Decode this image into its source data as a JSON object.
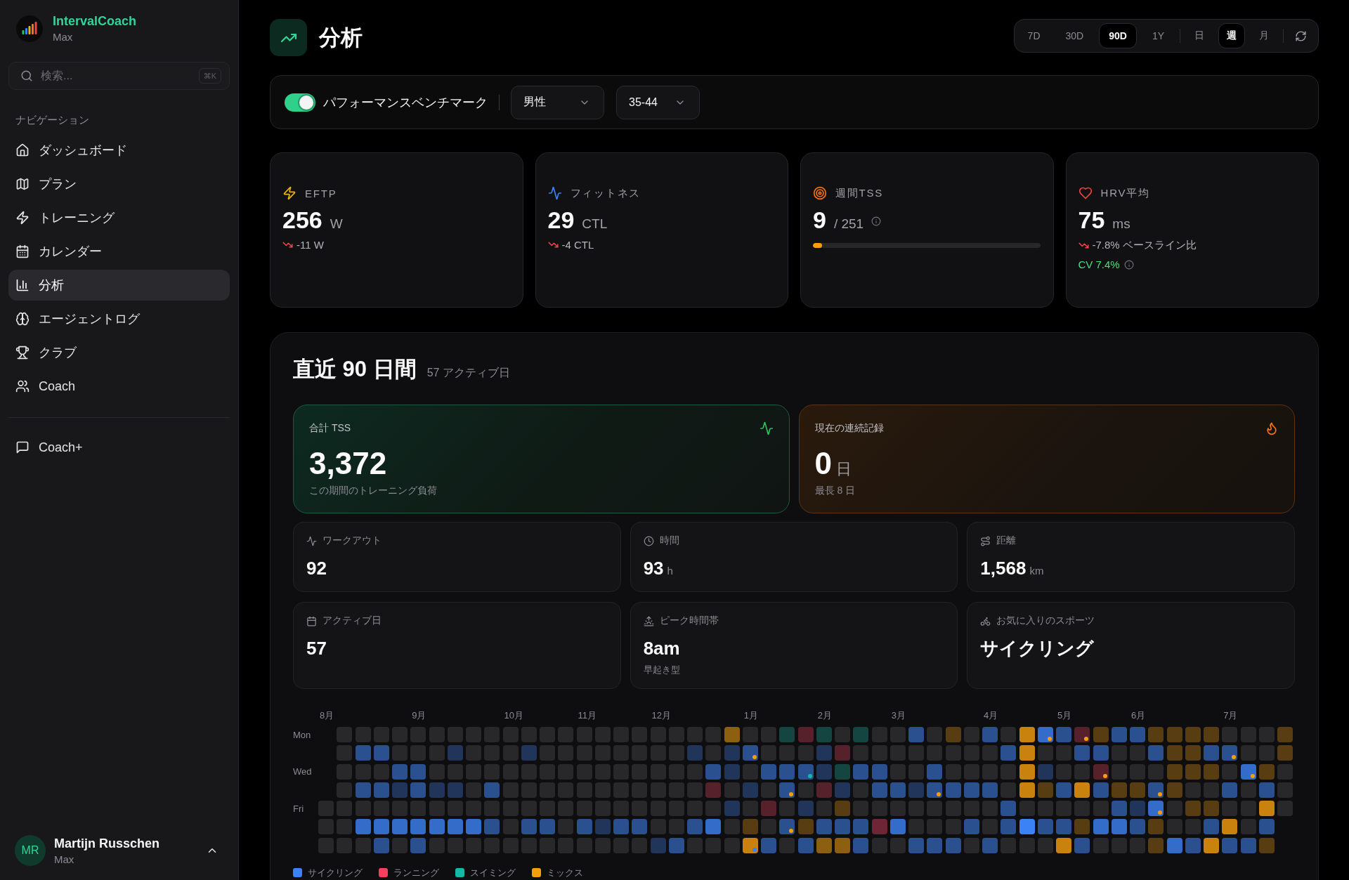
{
  "sidebar": {
    "brand": {
      "name": "IntervalCoach",
      "plan": "Max"
    },
    "search": {
      "placeholder": "検索...",
      "shortcut": "⌘K"
    },
    "section_label": "ナビゲーション",
    "items": [
      {
        "label": "ダッシュボード",
        "selected": false
      },
      {
        "label": "プラン",
        "selected": false
      },
      {
        "label": "トレーニング",
        "selected": false
      },
      {
        "label": "カレンダー",
        "selected": false
      },
      {
        "label": "分析",
        "selected": true
      },
      {
        "label": "エージェントログ",
        "selected": false
      },
      {
        "label": "クラブ",
        "selected": false
      },
      {
        "label": "Coach",
        "selected": false
      }
    ],
    "secondary_items": [
      {
        "label": "Coach+",
        "selected": false
      }
    ],
    "user": {
      "initials": "MR",
      "name": "Martijn Russchen",
      "plan": "Max"
    }
  },
  "header": {
    "title": "分析",
    "ranges": [
      {
        "label": "7D",
        "selected": false
      },
      {
        "label": "30D",
        "selected": false
      },
      {
        "label": "90D",
        "selected": true
      },
      {
        "label": "1Y",
        "selected": false
      }
    ],
    "granularity": [
      {
        "label": "日",
        "selected": false
      },
      {
        "label": "週",
        "selected": true
      },
      {
        "label": "月",
        "selected": false
      }
    ]
  },
  "benchmark": {
    "enabled": true,
    "label": "パフォーマンスベンチマーク",
    "gender": "男性",
    "age_group": "35-44"
  },
  "stats": [
    {
      "kind": "trend",
      "label": "EFTP",
      "value": "256",
      "unit": "W",
      "falling": true,
      "change": "-11 W"
    },
    {
      "kind": "trend",
      "label": "フィットネス",
      "value": "29",
      "unit": "CTL",
      "falling": true,
      "change": "-4 CTL"
    },
    {
      "kind": "progress",
      "label": "週間TSS",
      "value": "9",
      "target": "/ 251",
      "level": 0.04
    },
    {
      "kind": "trend",
      "label": "HRV平均",
      "value": "75",
      "unit": "ms",
      "falling": true,
      "change": "-7.8% ベースライン比",
      "note": "CV 7.4%"
    }
  ],
  "summary": {
    "title": "直近 90 日間",
    "subtitle": "57 アクティブ日",
    "highlights": [
      {
        "kind": "load",
        "label": "合計 TSS",
        "value": "3,372",
        "caption": "この期間のトレーニング負荷"
      },
      {
        "kind": "streak",
        "label": "現在の連続記録",
        "value": "0",
        "unit": "日",
        "caption": "最長 8 日"
      }
    ],
    "metrics": [
      {
        "label": "ワークアウト",
        "value": "92"
      },
      {
        "label": "時間",
        "value": "93",
        "unit": "h"
      },
      {
        "label": "距離",
        "value": "1,568",
        "unit": "km"
      },
      {
        "label": "アクティブ日",
        "value": "57"
      },
      {
        "label": "ピーク時間帯",
        "value": "8am",
        "caption": "早起き型"
      },
      {
        "label": "お気に入りのスポーツ",
        "value": "サイクリング"
      }
    ],
    "heatmap": {
      "day_labels": [
        "Mon",
        "Wed",
        "Fri"
      ],
      "weeks": [
        {
          "month": "8月",
          "days": [
            {
              "color": "#28282b"
            },
            {
              "color": "#28282b"
            },
            {
              "color": "#28282b"
            }
          ]
        },
        {
          "days": [
            {
              "color": "#28282b"
            },
            {
              "color": "#28282b"
            },
            {
              "color": "#28282b"
            },
            {
              "color": "#28282b"
            },
            {
              "color": "#28282b"
            },
            {
              "color": "#28282b"
            },
            {
              "color": "#28282b"
            }
          ]
        },
        {
          "days": [
            {
              "color": "#28282b"
            },
            {
              "color": "#2a508f"
            },
            {
              "color": "#28282b"
            },
            {
              "color": "#2a508f"
            },
            {
              "color": "#28282b"
            },
            {
              "color": "#336cc9"
            },
            {
              "color": "#28282b"
            }
          ]
        },
        {
          "days": [
            {
              "color": "#28282b"
            },
            {
              "color": "#2a508f"
            },
            {
              "color": "#28282b"
            },
            {
              "color": "#2a508f"
            },
            {
              "color": "#28282b"
            },
            {
              "color": "#336cc9"
            },
            {
              "color": "#2a508f"
            }
          ]
        },
        {
          "days": [
            {
              "color": "#28282b"
            },
            {
              "color": "#28282b"
            },
            {
              "color": "#2a508f"
            },
            {
              "color": "#203559"
            },
            {
              "color": "#28282b"
            },
            {
              "color": "#336cc9"
            },
            {
              "color": "#28282b"
            }
          ]
        },
        {
          "month": "9月",
          "days": [
            {
              "color": "#28282b"
            },
            {
              "color": "#28282b"
            },
            {
              "color": "#2a508f"
            },
            {
              "color": "#2a508f"
            },
            {
              "color": "#28282b"
            },
            {
              "color": "#336cc9"
            },
            {
              "color": "#2a508f"
            }
          ]
        },
        {
          "days": [
            {
              "color": "#28282b"
            },
            {
              "color": "#28282b"
            },
            {
              "color": "#28282b"
            },
            {
              "color": "#203559"
            },
            {
              "color": "#28282b"
            },
            {
              "color": "#336cc9"
            },
            {
              "color": "#28282b"
            }
          ]
        },
        {
          "days": [
            {
              "color": "#28282b"
            },
            {
              "color": "#203559"
            },
            {
              "color": "#28282b"
            },
            {
              "color": "#203559"
            },
            {
              "color": "#28282b"
            },
            {
              "color": "#336cc9"
            },
            {
              "color": "#28282b"
            }
          ]
        },
        {
          "days": [
            {
              "color": "#28282b"
            },
            {
              "color": "#28282b"
            },
            {
              "color": "#28282b"
            },
            {
              "color": "#28282b"
            },
            {
              "color": "#28282b"
            },
            {
              "color": "#336cc9"
            },
            {
              "color": "#28282b"
            }
          ]
        },
        {
          "days": [
            {
              "color": "#28282b"
            },
            {
              "color": "#28282b"
            },
            {
              "color": "#28282b"
            },
            {
              "color": "#2a508f"
            },
            {
              "color": "#28282b"
            },
            {
              "color": "#2a508f"
            },
            {
              "color": "#28282b"
            }
          ]
        },
        {
          "month": "10月",
          "days": [
            {
              "color": "#28282b"
            },
            {
              "color": "#28282b"
            },
            {
              "color": "#28282b"
            },
            {
              "color": "#28282b"
            },
            {
              "color": "#28282b"
            },
            {
              "color": "#28282b"
            },
            {
              "color": "#28282b"
            }
          ]
        },
        {
          "days": [
            {
              "color": "#28282b"
            },
            {
              "color": "#203559"
            },
            {
              "color": "#28282b"
            },
            {
              "color": "#28282b"
            },
            {
              "color": "#28282b"
            },
            {
              "color": "#2a508f"
            },
            {
              "color": "#28282b"
            }
          ]
        },
        {
          "days": [
            {
              "color": "#28282b"
            },
            {
              "color": "#28282b"
            },
            {
              "color": "#28282b"
            },
            {
              "color": "#28282b"
            },
            {
              "color": "#28282b"
            },
            {
              "color": "#2a508f"
            },
            {
              "color": "#28282b"
            }
          ]
        },
        {
          "days": [
            {
              "color": "#28282b"
            },
            {
              "color": "#28282b"
            },
            {
              "color": "#28282b"
            },
            {
              "color": "#28282b"
            },
            {
              "color": "#28282b"
            },
            {
              "color": "#28282b"
            },
            {
              "color": "#28282b"
            }
          ]
        },
        {
          "month": "11月",
          "days": [
            {
              "color": "#28282b"
            },
            {
              "color": "#28282b"
            },
            {
              "color": "#28282b"
            },
            {
              "color": "#28282b"
            },
            {
              "color": "#28282b"
            },
            {
              "color": "#2a508f"
            },
            {
              "color": "#28282b"
            }
          ]
        },
        {
          "days": [
            {
              "color": "#28282b"
            },
            {
              "color": "#28282b"
            },
            {
              "color": "#28282b"
            },
            {
              "color": "#28282b"
            },
            {
              "color": "#28282b"
            },
            {
              "color": "#203559"
            },
            {
              "color": "#28282b"
            }
          ]
        },
        {
          "days": [
            {
              "color": "#28282b"
            },
            {
              "color": "#28282b"
            },
            {
              "color": "#28282b"
            },
            {
              "color": "#28282b"
            },
            {
              "color": "#28282b"
            },
            {
              "color": "#2a508f"
            },
            {
              "color": "#28282b"
            }
          ]
        },
        {
          "days": [
            {
              "color": "#28282b"
            },
            {
              "color": "#28282b"
            },
            {
              "color": "#28282b"
            },
            {
              "color": "#28282b"
            },
            {
              "color": "#28282b"
            },
            {
              "color": "#2a508f"
            },
            {
              "color": "#28282b"
            }
          ]
        },
        {
          "month": "12月",
          "days": [
            {
              "color": "#28282b"
            },
            {
              "color": "#28282b"
            },
            {
              "color": "#28282b"
            },
            {
              "color": "#28282b"
            },
            {
              "color": "#28282b"
            },
            {
              "color": "#28282b"
            },
            {
              "color": "#203559"
            }
          ]
        },
        {
          "days": [
            {
              "color": "#28282b"
            },
            {
              "color": "#28282b"
            },
            {
              "color": "#28282b"
            },
            {
              "color": "#28282b"
            },
            {
              "color": "#28282b"
            },
            {
              "color": "#28282b"
            },
            {
              "color": "#2a508f"
            }
          ]
        },
        {
          "days": [
            {
              "color": "#28282b"
            },
            {
              "color": "#203559"
            },
            {
              "color": "#28282b"
            },
            {
              "color": "#28282b"
            },
            {
              "color": "#28282b"
            },
            {
              "color": "#2a508f"
            },
            {
              "color": "#28282b"
            }
          ]
        },
        {
          "days": [
            {
              "color": "#28282b"
            },
            {
              "color": "#28282b"
            },
            {
              "color": "#2a508f"
            },
            {
              "color": "#57212b"
            },
            {
              "color": "#28282b"
            },
            {
              "color": "#336cc9"
            },
            {
              "color": "#28282b"
            }
          ]
        },
        {
          "days": [
            {
              "color": "#8d5f10"
            },
            {
              "color": "#203559"
            },
            {
              "color": "#203559"
            },
            {
              "color": "#28282b"
            },
            {
              "color": "#203559"
            },
            {
              "color": "#28282b"
            },
            {
              "color": "#28282b"
            }
          ]
        },
        {
          "month": "1月",
          "days": [
            {
              "color": "#28282b"
            },
            {
              "color": "#2a508f",
              "dot": {
                "color": "#f59e0b"
              }
            },
            {
              "color": "#28282b"
            },
            {
              "color": "#203559"
            },
            {
              "color": "#28282b"
            },
            {
              "color": "#583d13"
            },
            {
              "color": "#c8820d",
              "dot": {
                "color": "#3b82f6"
              }
            }
          ]
        },
        {
          "days": [
            {
              "color": "#28282b"
            },
            {
              "color": "#28282b"
            },
            {
              "color": "#2a508f"
            },
            {
              "color": "#28282b"
            },
            {
              "color": "#57212b"
            },
            {
              "color": "#28282b"
            },
            {
              "color": "#2a508f"
            }
          ]
        },
        {
          "days": [
            {
              "color": "#144541"
            },
            {
              "color": "#28282b"
            },
            {
              "color": "#2a508f"
            },
            {
              "color": "#2a508f",
              "dot": {
                "color": "#f59e0b"
              }
            },
            {
              "color": "#28282b"
            },
            {
              "color": "#2a508f",
              "dot": {
                "color": "#f59e0b"
              }
            },
            {
              "color": "#28282b"
            }
          ]
        },
        {
          "days": [
            {
              "color": "#57212b"
            },
            {
              "color": "#28282b"
            },
            {
              "color": "#2a508f",
              "dot": {
                "color": "#14b8a6"
              }
            },
            {
              "color": "#28282b"
            },
            {
              "color": "#203559"
            },
            {
              "color": "#583d13"
            },
            {
              "color": "#2a508f"
            }
          ]
        },
        {
          "month": "2月",
          "days": [
            {
              "color": "#144541"
            },
            {
              "color": "#203559"
            },
            {
              "color": "#203559"
            },
            {
              "color": "#57212b"
            },
            {
              "color": "#28282b"
            },
            {
              "color": "#2a508f"
            },
            {
              "color": "#8d5f10"
            }
          ]
        },
        {
          "days": [
            {
              "color": "#28282b"
            },
            {
              "color": "#57212b"
            },
            {
              "color": "#144541"
            },
            {
              "color": "#203559"
            },
            {
              "color": "#583d13"
            },
            {
              "color": "#2a508f"
            },
            {
              "color": "#8d5f10"
            }
          ]
        },
        {
          "days": [
            {
              "color": "#144541"
            },
            {
              "color": "#28282b"
            },
            {
              "color": "#2a508f"
            },
            {
              "color": "#28282b"
            },
            {
              "color": "#28282b"
            },
            {
              "color": "#2a508f"
            },
            {
              "color": "#2a508f"
            }
          ]
        },
        {
          "days": [
            {
              "color": "#28282b"
            },
            {
              "color": "#28282b"
            },
            {
              "color": "#2a508f"
            },
            {
              "color": "#2a508f"
            },
            {
              "color": "#28282b"
            },
            {
              "color": "#6e2535"
            },
            {
              "color": "#28282b"
            }
          ]
        },
        {
          "month": "3月",
          "days": [
            {
              "color": "#28282b"
            },
            {
              "color": "#28282b"
            },
            {
              "color": "#28282b"
            },
            {
              "color": "#2a508f"
            },
            {
              "color": "#28282b"
            },
            {
              "color": "#336cc9"
            },
            {
              "color": "#28282b"
            }
          ]
        },
        {
          "days": [
            {
              "color": "#2a508f"
            },
            {
              "color": "#28282b"
            },
            {
              "color": "#28282b"
            },
            {
              "color": "#203559"
            },
            {
              "color": "#28282b"
            },
            {
              "color": "#28282b"
            },
            {
              "color": "#2a508f"
            }
          ]
        },
        {
          "days": [
            {
              "color": "#28282b"
            },
            {
              "color": "#28282b"
            },
            {
              "color": "#2a508f"
            },
            {
              "color": "#2a508f",
              "dot": {
                "color": "#f59e0b"
              }
            },
            {
              "color": "#28282b"
            },
            {
              "color": "#28282b"
            },
            {
              "color": "#2a508f"
            }
          ]
        },
        {
          "days": [
            {
              "color": "#583d13"
            },
            {
              "color": "#28282b"
            },
            {
              "color": "#28282b"
            },
            {
              "color": "#2a508f"
            },
            {
              "color": "#28282b"
            },
            {
              "color": "#28282b"
            },
            {
              "color": "#2a508f"
            }
          ]
        },
        {
          "days": [
            {
              "color": "#28282b"
            },
            {
              "color": "#28282b"
            },
            {
              "color": "#28282b"
            },
            {
              "color": "#2a508f"
            },
            {
              "color": "#28282b"
            },
            {
              "color": "#2a508f"
            },
            {
              "color": "#28282b"
            }
          ]
        },
        {
          "month": "4月",
          "days": [
            {
              "color": "#2a508f"
            },
            {
              "color": "#28282b"
            },
            {
              "color": "#28282b"
            },
            {
              "color": "#2a508f"
            },
            {
              "color": "#28282b"
            },
            {
              "color": "#28282b"
            },
            {
              "color": "#2a508f"
            }
          ]
        },
        {
          "days": [
            {
              "color": "#28282b"
            },
            {
              "color": "#2a508f"
            },
            {
              "color": "#28282b"
            },
            {
              "color": "#28282b"
            },
            {
              "color": "#2a508f"
            },
            {
              "color": "#2a508f"
            },
            {
              "color": "#28282b"
            }
          ]
        },
        {
          "days": [
            {
              "color": "#c8820d"
            },
            {
              "color": "#c8820d"
            },
            {
              "color": "#c8820d"
            },
            {
              "color": "#c8820d"
            },
            {
              "color": "#28282b"
            },
            {
              "color": "#3b82f6"
            },
            {
              "color": "#28282b"
            }
          ]
        },
        {
          "days": [
            {
              "color": "#336cc9",
              "dot": {
                "color": "#f59e0b"
              }
            },
            {
              "color": "#28282b"
            },
            {
              "color": "#203559"
            },
            {
              "color": "#583d13"
            },
            {
              "color": "#28282b"
            },
            {
              "color": "#2a508f"
            },
            {
              "color": "#28282b"
            }
          ]
        },
        {
          "month": "5月",
          "days": [
            {
              "color": "#2a508f"
            },
            {
              "color": "#28282b"
            },
            {
              "color": "#28282b"
            },
            {
              "color": "#2a508f"
            },
            {
              "color": "#28282b"
            },
            {
              "color": "#2a508f"
            },
            {
              "color": "#c8820d"
            }
          ]
        },
        {
          "days": [
            {
              "color": "#57212b",
              "dot": {
                "color": "#f59e0b"
              }
            },
            {
              "color": "#2a508f"
            },
            {
              "color": "#28282b"
            },
            {
              "color": "#c8820d"
            },
            {
              "color": "#28282b"
            },
            {
              "color": "#583d13"
            },
            {
              "color": "#2a508f"
            }
          ]
        },
        {
          "days": [
            {
              "color": "#583d13"
            },
            {
              "color": "#2a508f"
            },
            {
              "color": "#57212b",
              "dot": {
                "color": "#f59e0b"
              }
            },
            {
              "color": "#2a508f"
            },
            {
              "color": "#28282b"
            },
            {
              "color": "#336cc9"
            },
            {
              "color": "#28282b"
            }
          ]
        },
        {
          "days": [
            {
              "color": "#2a508f"
            },
            {
              "color": "#28282b"
            },
            {
              "color": "#28282b"
            },
            {
              "color": "#583d13"
            },
            {
              "color": "#2a508f"
            },
            {
              "color": "#336cc9"
            },
            {
              "color": "#28282b"
            }
          ]
        },
        {
          "month": "6月",
          "days": [
            {
              "color": "#2a508f"
            },
            {
              "color": "#28282b"
            },
            {
              "color": "#28282b"
            },
            {
              "color": "#583d13"
            },
            {
              "color": "#203559"
            },
            {
              "color": "#2a508f"
            },
            {
              "color": "#28282b"
            }
          ]
        },
        {
          "days": [
            {
              "color": "#583d13"
            },
            {
              "color": "#2a508f"
            },
            {
              "color": "#28282b"
            },
            {
              "color": "#2a508f",
              "dot": {
                "color": "#f59e0b"
              }
            },
            {
              "color": "#336cc9",
              "dot": {
                "color": "#f59e0b"
              }
            },
            {
              "color": "#583d13"
            },
            {
              "color": "#583d13"
            }
          ]
        },
        {
          "days": [
            {
              "color": "#583d13"
            },
            {
              "color": "#583d13"
            },
            {
              "color": "#583d13"
            },
            {
              "color": "#583d13"
            },
            {
              "color": "#28282b"
            },
            {
              "color": "#28282b"
            },
            {
              "color": "#336cc9"
            }
          ]
        },
        {
          "days": [
            {
              "color": "#583d13"
            },
            {
              "color": "#583d13"
            },
            {
              "color": "#583d13"
            },
            {
              "color": "#28282b"
            },
            {
              "color": "#583d13"
            },
            {
              "color": "#28282b"
            },
            {
              "color": "#2a508f"
            }
          ]
        },
        {
          "days": [
            {
              "color": "#583d13"
            },
            {
              "color": "#2a508f"
            },
            {
              "color": "#583d13"
            },
            {
              "color": "#28282b"
            },
            {
              "color": "#583d13"
            },
            {
              "color": "#2a508f"
            },
            {
              "color": "#c8820d"
            }
          ]
        },
        {
          "month": "7月",
          "days": [
            {
              "color": "#28282b"
            },
            {
              "color": "#2a508f",
              "dot": {
                "color": "#f59e0b"
              }
            },
            {
              "color": "#28282b"
            },
            {
              "color": "#2a508f"
            },
            {
              "color": "#28282b"
            },
            {
              "color": "#c8820d"
            },
            {
              "color": "#2a508f"
            }
          ]
        },
        {
          "days": [
            {
              "color": "#28282b"
            },
            {
              "color": "#28282b"
            },
            {
              "color": "#336cc9",
              "dot": {
                "color": "#f59e0b"
              }
            },
            {
              "color": "#28282b"
            },
            {
              "color": "#28282b"
            },
            {
              "color": "#28282b"
            },
            {
              "color": "#2a508f"
            }
          ]
        },
        {
          "days": [
            {
              "color": "#28282b"
            },
            {
              "color": "#28282b"
            },
            {
              "color": "#583d13"
            },
            {
              "color": "#2a508f"
            },
            {
              "color": "#c8820d"
            },
            {
              "color": "#2a508f"
            },
            {
              "color": "#583d13"
            }
          ]
        },
        {
          "days": [
            {
              "color": "#583d13"
            },
            {
              "color": "#583d13"
            },
            {
              "color": "#28282b"
            },
            {
              "color": "#28282b"
            },
            {
              "color": "#28282b"
            }
          ]
        }
      ],
      "legend": [
        {
          "label": "サイクリング",
          "color": "#3b82f6"
        },
        {
          "label": "ランニング",
          "color": "#f43f5e"
        },
        {
          "label": "スイミング",
          "color": "#14b8a6"
        },
        {
          "label": "ミックス",
          "color": "#f59e0b"
        }
      ]
    }
  }
}
